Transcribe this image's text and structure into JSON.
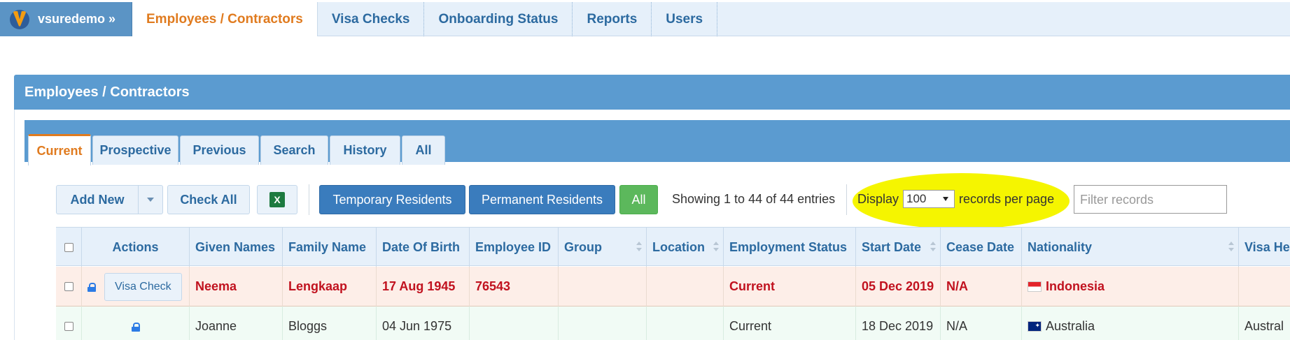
{
  "nav": {
    "brand": "vsuredemo »",
    "tabs": [
      "Employees / Contractors",
      "Visa Checks",
      "Onboarding Status",
      "Reports",
      "Users"
    ],
    "active_tab": "Employees / Contractors"
  },
  "panel": {
    "title": "Employees / Contractors",
    "subtabs": [
      "Current",
      "Prospective",
      "Previous",
      "Search",
      "History",
      "All"
    ],
    "active_subtab": "Current"
  },
  "toolbar": {
    "add_new": "Add New",
    "check_all": "Check All",
    "excel_icon": "X",
    "temporary": "Temporary Residents",
    "permanent": "Permanent Residents",
    "all": "All",
    "showing": "Showing 1 to 44 of 44 entries",
    "display_prefix": "Display",
    "page_size": "100",
    "display_suffix": "records per page",
    "filter_placeholder": "Filter records"
  },
  "table": {
    "columns": [
      "Actions",
      "Given Names",
      "Family Name",
      "Date Of Birth",
      "Employee ID",
      "Group",
      "Location",
      "Employment Status",
      "Start Date",
      "Cease Date",
      "Nationality",
      "Visa He"
    ],
    "rows": [
      {
        "action": "Visa Check",
        "given": "Neema",
        "family": "Lengkaap",
        "dob": "17 Aug 1945",
        "emp_id": "76543",
        "group": "",
        "location": "",
        "status": "Current",
        "start": "05 Dec 2019",
        "cease": "N/A",
        "nationality": "Indonesia",
        "visa": ""
      },
      {
        "action": "",
        "given": "Joanne",
        "family": "Bloggs",
        "dob": "04 Jun 1975",
        "emp_id": "",
        "group": "",
        "location": "",
        "status": "Current",
        "start": "18 Dec 2019",
        "cease": "N/A",
        "nationality": "Australia",
        "visa": "Austral"
      }
    ]
  },
  "colors": {
    "nav_bg": "#e6f0fa",
    "panel_blue": "#5b9bd0",
    "active_orange": "#e07b1f",
    "highlight": "#f5f500",
    "row_alert": "#fdeee8",
    "row_ok": "#f1fbf5",
    "alert_text": "#c1121f"
  }
}
